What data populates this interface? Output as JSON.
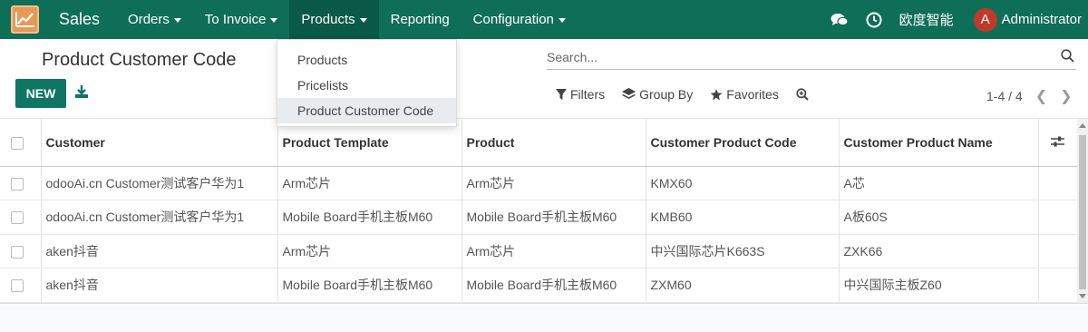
{
  "navbar": {
    "app_name": "Sales",
    "menu": [
      {
        "label": "Orders",
        "has_caret": true
      },
      {
        "label": "To Invoice",
        "has_caret": true
      },
      {
        "label": "Products",
        "has_caret": true
      },
      {
        "label": "Reporting",
        "has_caret": false
      },
      {
        "label": "Configuration",
        "has_caret": true
      }
    ],
    "company": "欧度智能",
    "avatar_letter": "A",
    "user": "Administrator",
    "colors": {
      "bar": "#0f6e58",
      "active": "#0a5a47",
      "avatar": "#c0392b"
    }
  },
  "products_menu": {
    "items": [
      "Products",
      "Pricelists",
      "Product Customer Code"
    ],
    "active_index": 2
  },
  "control": {
    "title": "Product Customer Code",
    "new_label": "NEW",
    "search_placeholder": "Search...",
    "filters_label": "Filters",
    "groupby_label": "Group By",
    "favorites_label": "Favorites",
    "pager": "1-4 / 4"
  },
  "table": {
    "columns": [
      "Customer",
      "Product Template",
      "Product",
      "Customer Product Code",
      "Customer Product Name"
    ],
    "rows": [
      [
        "odooAi.cn Customer测试客户华为1",
        "Arm芯片",
        "Arm芯片",
        "KMX60",
        "A芯"
      ],
      [
        "odooAi.cn Customer测试客户华为1",
        "Mobile Board手机主板M60",
        "Mobile Board手机主板M60",
        "KMB60",
        "A板60S"
      ],
      [
        "aken抖音",
        "Arm芯片",
        "Arm芯片",
        "中兴国际芯片K663S",
        "ZXK66"
      ],
      [
        "aken抖音",
        "Mobile Board手机主板M60",
        "Mobile Board手机主板M60",
        "ZXM60",
        "中兴国际主板Z60"
      ]
    ]
  }
}
